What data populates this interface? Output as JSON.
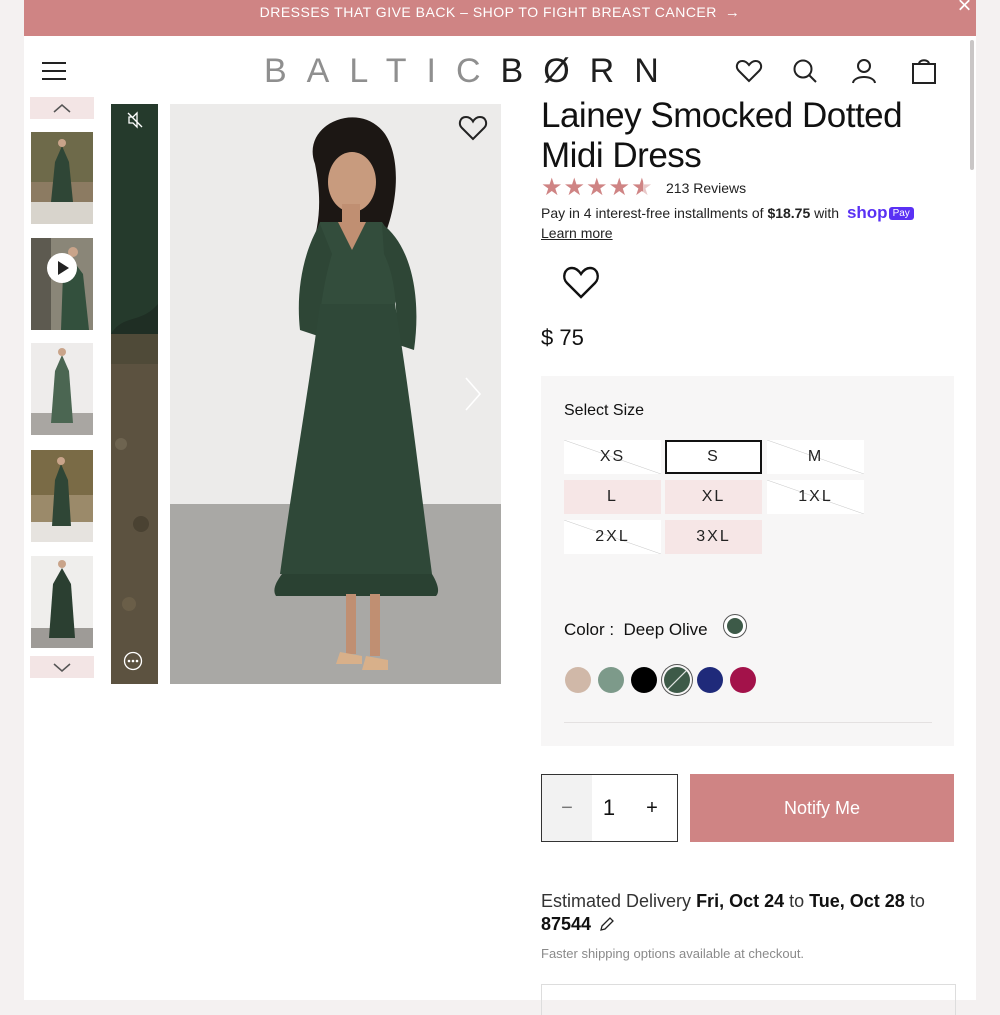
{
  "banner": {
    "text": "DRESSES THAT GIVE BACK – SHOP TO FIGHT BREAST CANCER",
    "arrow": "→",
    "close": "×"
  },
  "header": {
    "logo_light": "BALTIC",
    "logo_dark": "BØRN",
    "icons": [
      "menu-icon",
      "heart-icon",
      "search-icon",
      "account-icon",
      "bag-icon"
    ]
  },
  "product": {
    "title": "Lainey Smocked Dotted Midi Dress",
    "rating": 4.5,
    "reviews": "213 Reviews",
    "installments_prefix": "Pay in 4 interest-free installments of ",
    "installment_amount": "$18.75",
    "installments_with": " with ",
    "shop_brand": "shop",
    "shop_pay": "Pay",
    "learn_more": "Learn more",
    "price": "$ 75"
  },
  "options": {
    "size_label": "Select Size",
    "sizes": [
      {
        "label": "XS",
        "state": "unavailable"
      },
      {
        "label": "S",
        "state": "selected"
      },
      {
        "label": "M",
        "state": "unavailable"
      },
      {
        "label": "L",
        "state": "available"
      },
      {
        "label": "XL",
        "state": "available"
      },
      {
        "label": "1XL",
        "state": "unavailable"
      },
      {
        "label": "2XL",
        "state": "unavailable"
      },
      {
        "label": "3XL",
        "state": "available"
      }
    ],
    "color_label": "Color :",
    "color_value": "Deep Olive",
    "swatches": [
      "#d0b8a8",
      "#7d9a8a",
      "#000000",
      "#3d5a48",
      "#1f2a7a",
      "#a3124a"
    ],
    "selected_swatch": 3
  },
  "cart": {
    "qty_minus": "−",
    "qty_value": "1",
    "qty_plus": "+",
    "notify": "Notify Me"
  },
  "delivery": {
    "prefix": "Estimated Delivery ",
    "start": "Fri, Oct 24",
    "mid": " to ",
    "end": "Tue, Oct 28",
    "to": " to ",
    "zip": "87544",
    "note": "Faster shipping options available at checkout."
  }
}
